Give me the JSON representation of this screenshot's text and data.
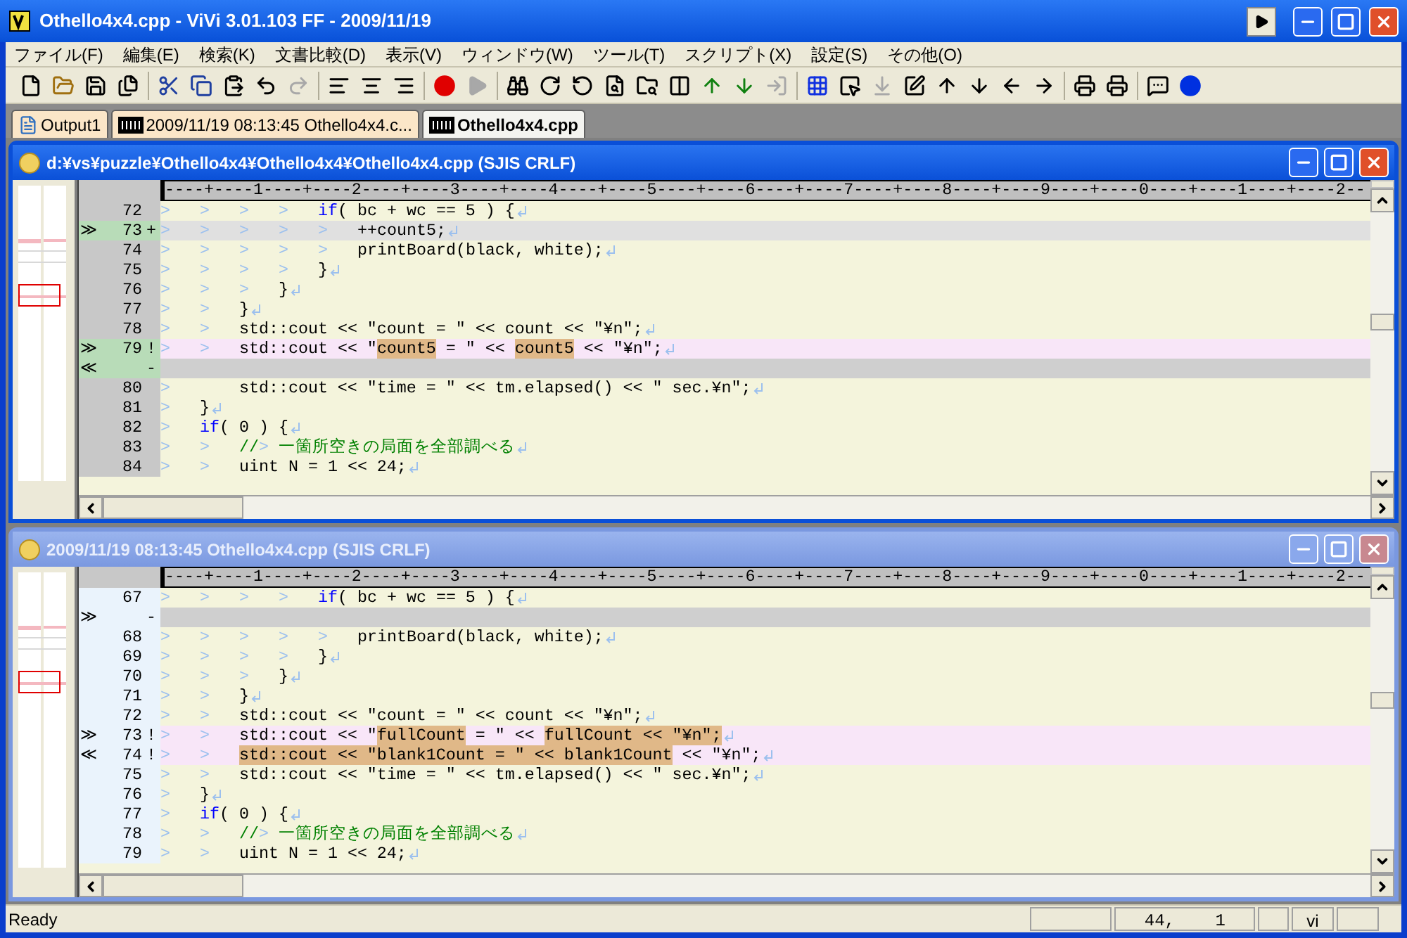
{
  "window": {
    "title": "Othello4x4.cpp - ViVi 3.01.103 FF - 2009/11/19"
  },
  "menu": [
    "ファイル(F)",
    "編集(E)",
    "検索(K)",
    "文書比較(D)",
    "表示(V)",
    "ウィンドウ(W)",
    "ツール(T)",
    "スクリプト(X)",
    "設定(S)",
    "その他(O)"
  ],
  "toolbar": [
    [
      {
        "kind": "new",
        "disabled": false
      },
      {
        "kind": "open",
        "disabled": false
      },
      {
        "kind": "save",
        "disabled": false
      },
      {
        "kind": "saveall",
        "disabled": false
      }
    ],
    [
      {
        "kind": "cut",
        "disabled": false
      },
      {
        "kind": "copy",
        "disabled": false
      },
      {
        "kind": "paste",
        "disabled": false
      },
      {
        "kind": "undo",
        "disabled": false
      },
      {
        "kind": "redo",
        "disabled": true
      }
    ],
    [
      {
        "kind": "alignleft",
        "disabled": false
      },
      {
        "kind": "aligncenter",
        "disabled": false
      },
      {
        "kind": "alignright",
        "disabled": false
      }
    ],
    [
      {
        "kind": "record",
        "disabled": false
      },
      {
        "kind": "play",
        "disabled": true
      }
    ],
    [
      {
        "kind": "find",
        "disabled": false
      },
      {
        "kind": "findnext",
        "disabled": false
      },
      {
        "kind": "findprev",
        "disabled": false
      },
      {
        "kind": "findfile",
        "disabled": false
      },
      {
        "kind": "findfolder",
        "disabled": false
      },
      {
        "kind": "diff",
        "disabled": false
      },
      {
        "kind": "prevdiff",
        "disabled": false
      },
      {
        "kind": "nextdiff",
        "disabled": false
      },
      {
        "kind": "merge",
        "disabled": true
      }
    ],
    [
      {
        "kind": "grid",
        "disabled": false
      },
      {
        "kind": "select",
        "disabled": false
      },
      {
        "kind": "jump",
        "disabled": true
      },
      {
        "kind": "edit",
        "disabled": false
      },
      {
        "kind": "up",
        "disabled": false
      },
      {
        "kind": "down",
        "disabled": false
      },
      {
        "kind": "left",
        "disabled": false
      },
      {
        "kind": "right",
        "disabled": false
      }
    ],
    [
      {
        "kind": "print",
        "disabled": false
      },
      {
        "kind": "preview",
        "disabled": false
      }
    ],
    [
      {
        "kind": "comment",
        "disabled": false
      },
      {
        "kind": "info",
        "disabled": false
      }
    ]
  ],
  "tabs": [
    {
      "label": "Output1",
      "kind": "output",
      "selected": false
    },
    {
      "label": "2009/11/19 08:13:45 Othello4x4.c...",
      "kind": "diff",
      "selected": false
    },
    {
      "label": "Othello4x4.cpp",
      "kind": "diff",
      "selected": true
    }
  ],
  "panes": [
    {
      "title": "d:¥vs¥puzzle¥Othello4x4¥Othello4x4¥Othello4x4.cpp (SJIS CRLF)",
      "active": true,
      "ruler": "----+----1----+----2----+----3----+----4----+----5----+----6----+----7----+----8----+----9----+----0----+----1----+----2--",
      "lines": [
        {
          "number": "72",
          "kind": "normal",
          "tabs": [
            ">",
            ">",
            ">",
            ">"
          ],
          "tokens": [
            {
              "text": "if",
              "kind": "keyword"
            },
            {
              "text": "( bc + wc == 5 ) {",
              "kind": "plain"
            }
          ],
          "eol": true
        },
        {
          "mark": "≫",
          "number": "73",
          "flag": "+",
          "kind": "added",
          "tabs": [
            ">",
            ">",
            ">",
            ">",
            ">"
          ],
          "tokens": [
            {
              "text": "++count5;",
              "kind": "plain"
            }
          ],
          "eol": true
        },
        {
          "number": "74",
          "kind": "normal",
          "tabs": [
            ">",
            ">",
            ">",
            ">",
            ">"
          ],
          "tokens": [
            {
              "text": "printBoard(black, white);",
              "kind": "plain"
            }
          ],
          "eol": true
        },
        {
          "number": "75",
          "kind": "normal",
          "tabs": [
            ">",
            ">",
            ">",
            ">"
          ],
          "tokens": [
            {
              "text": "}",
              "kind": "plain"
            }
          ],
          "eol": true
        },
        {
          "number": "76",
          "kind": "normal",
          "tabs": [
            ">",
            ">",
            ">"
          ],
          "tokens": [
            {
              "text": "}",
              "kind": "plain"
            }
          ],
          "eol": true
        },
        {
          "number": "77",
          "kind": "normal",
          "tabs": [
            ">",
            ">"
          ],
          "tokens": [
            {
              "text": "}",
              "kind": "plain"
            }
          ],
          "eol": true
        },
        {
          "number": "78",
          "kind": "normal",
          "tabs": [
            ">",
            ">"
          ],
          "tokens": [
            {
              "text": "std::cout << \"count = \" << count << \"¥n\";",
              "kind": "plain"
            }
          ],
          "eol": true
        },
        {
          "mark": "≫",
          "number": "79",
          "flag": "!",
          "kind": "changed",
          "tabs": [
            ">",
            ">"
          ],
          "tokens": [
            {
              "text": "std::cout << \"",
              "kind": "plain"
            },
            {
              "text": "count5",
              "kind": "highlight"
            },
            {
              "text": " = \" << ",
              "kind": "plain"
            },
            {
              "text": "count5",
              "kind": "highlight"
            },
            {
              "text": " << \"¥n\";",
              "kind": "plain"
            }
          ],
          "eol": true
        },
        {
          "mark": "≪",
          "flag": "-",
          "kind": "deleted",
          "eol": false
        },
        {
          "number": "80",
          "kind": "normal",
          "tabs": [
            ">"
          ],
          "tokens": [
            {
              "text": "    std::cout << \"time = \" << tm.elapsed() << \" sec.¥n\";",
              "kind": "plain"
            }
          ],
          "eol": true
        },
        {
          "number": "81",
          "kind": "normal",
          "tabs": [
            ">"
          ],
          "tokens": [
            {
              "text": "}",
              "kind": "plain"
            }
          ],
          "eol": true
        },
        {
          "number": "82",
          "kind": "normal",
          "tabs": [
            ">"
          ],
          "tokens": [
            {
              "text": "if",
              "kind": "keyword"
            },
            {
              "text": "( 0 ) {",
              "kind": "plain"
            }
          ],
          "eol": true
        },
        {
          "number": "83",
          "kind": "normal",
          "tabs": [
            ">",
            ">"
          ],
          "tokens": [
            {
              "text": "//",
              "kind": "comment"
            },
            {
              "text": ">",
              "kind": "tab"
            },
            {
              "text": "一箇所空きの局面を全部調べる",
              "kind": "comment"
            }
          ],
          "eol": true
        },
        {
          "number": "84",
          "kind": "normal",
          "tabs": [
            ">",
            ">"
          ],
          "tokens": [
            {
              "text": "uint N = 1 << 24;",
              "kind": "plain"
            }
          ],
          "eol": true
        }
      ]
    },
    {
      "title": "2009/11/19 08:13:45 Othello4x4.cpp (SJIS CRLF)",
      "active": false,
      "ruler": "----+----1----+----2----+----3----+----4----+----5----+----6----+----7----+----8----+----9----+----0----+----1----+----2--",
      "lines": [
        {
          "number": "67",
          "kind": "normal",
          "tabs": [
            ">",
            ">",
            ">",
            ">"
          ],
          "tokens": [
            {
              "text": "if",
              "kind": "keyword"
            },
            {
              "text": "( bc + wc == 5 ) {",
              "kind": "plain"
            }
          ],
          "eol": true
        },
        {
          "mark": "≫",
          "flag": "-",
          "kind": "deleted",
          "eol": false
        },
        {
          "number": "68",
          "kind": "normal",
          "tabs": [
            ">",
            ">",
            ">",
            ">",
            ">"
          ],
          "tokens": [
            {
              "text": "printBoard(black, white);",
              "kind": "plain"
            }
          ],
          "eol": true
        },
        {
          "number": "69",
          "kind": "normal",
          "tabs": [
            ">",
            ">",
            ">",
            ">"
          ],
          "tokens": [
            {
              "text": "}",
              "kind": "plain"
            }
          ],
          "eol": true
        },
        {
          "number": "70",
          "kind": "normal",
          "tabs": [
            ">",
            ">",
            ">"
          ],
          "tokens": [
            {
              "text": "}",
              "kind": "plain"
            }
          ],
          "eol": true
        },
        {
          "number": "71",
          "kind": "normal",
          "tabs": [
            ">",
            ">"
          ],
          "tokens": [
            {
              "text": "}",
              "kind": "plain"
            }
          ],
          "eol": true
        },
        {
          "number": "72",
          "kind": "normal",
          "tabs": [
            ">",
            ">"
          ],
          "tokens": [
            {
              "text": "std::cout << \"count = \" << count << \"¥n\";",
              "kind": "plain"
            }
          ],
          "eol": true
        },
        {
          "mark": "≫",
          "number": "73",
          "flag": "!",
          "kind": "changed",
          "tabs": [
            ">",
            ">"
          ],
          "tokens": [
            {
              "text": "std::cout << \"",
              "kind": "plain"
            },
            {
              "text": "fullCount",
              "kind": "highlight"
            },
            {
              "text": " = \" << ",
              "kind": "plain"
            },
            {
              "text": "fullCount << \"¥n\";",
              "kind": "highlight"
            }
          ],
          "eol": true
        },
        {
          "mark": "≪",
          "number": "74",
          "flag": "!",
          "kind": "changed",
          "tabs": [
            ">",
            ">"
          ],
          "tokens": [
            {
              "text": "std::cout << \"blank1Count = \" << blank1Count",
              "kind": "highlight"
            },
            {
              "text": " << \"¥n\";",
              "kind": "plain"
            }
          ],
          "eol": true
        },
        {
          "number": "75",
          "kind": "normal",
          "tabs": [
            ">",
            ">"
          ],
          "tokens": [
            {
              "text": "std::cout << \"time = \" << tm.elapsed() << \" sec.¥n\";",
              "kind": "plain"
            }
          ],
          "eol": true
        },
        {
          "number": "76",
          "kind": "normal",
          "tabs": [
            ">"
          ],
          "tokens": [
            {
              "text": "}",
              "kind": "plain"
            }
          ],
          "eol": true
        },
        {
          "number": "77",
          "kind": "normal",
          "tabs": [
            ">"
          ],
          "tokens": [
            {
              "text": "if",
              "kind": "keyword"
            },
            {
              "text": "( 0 ) {",
              "kind": "plain"
            }
          ],
          "eol": true
        },
        {
          "number": "78",
          "kind": "normal",
          "tabs": [
            ">",
            ">"
          ],
          "tokens": [
            {
              "text": "//",
              "kind": "comment"
            },
            {
              "text": ">",
              "kind": "tab"
            },
            {
              "text": "一箇所空きの局面を全部調べる",
              "kind": "comment"
            }
          ],
          "eol": true
        },
        {
          "number": "79",
          "kind": "normal",
          "tabs": [
            ">",
            ">"
          ],
          "tokens": [
            {
              "text": "uint N = 1 << 24;",
              "kind": "plain"
            }
          ],
          "eol": true
        }
      ]
    }
  ],
  "status_bar": {
    "text": "Ready",
    "position": "44,    1",
    "mode": "vi"
  }
}
